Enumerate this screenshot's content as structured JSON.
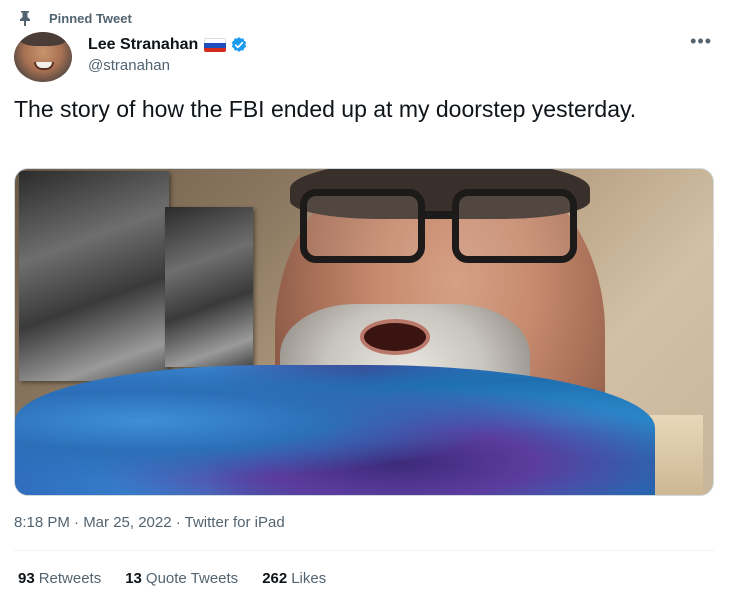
{
  "pinned": {
    "label": "Pinned Tweet"
  },
  "user": {
    "display_name": "Lee Stranahan",
    "handle": "@stranahan",
    "flag_colors": [
      "#ffffff",
      "#1f4fbf",
      "#d52b1e"
    ],
    "verified_color": "#1d9bf0"
  },
  "tweet": {
    "text": "The story of how the FBI ended up at my doorstep yesterday.",
    "timestamp": "8:18 PM · Mar 25, 2022 · Twitter for iPad"
  },
  "stats": [
    {
      "count": "93",
      "label": "Retweets"
    },
    {
      "count": "13",
      "label": "Quote Tweets"
    },
    {
      "count": "262",
      "label": "Likes"
    }
  ],
  "icons": {
    "pin": "pin-icon",
    "verified": "verified-badge-icon",
    "more": "more-options-icon"
  }
}
